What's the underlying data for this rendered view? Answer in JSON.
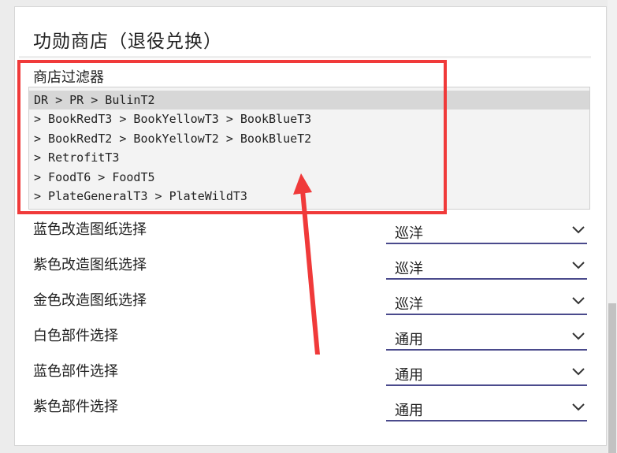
{
  "page": {
    "title": "功勋商店（退役兑换）"
  },
  "filter": {
    "label": "商店过滤器",
    "lines": [
      "DR > PR > BulinT2",
      "> BookRedT3 > BookYellowT3 > BookBlueT3",
      "> BookRedT2 > BookYellowT2 > BookBlueT2",
      "> RetrofitT3",
      "> FoodT6 > FoodT5",
      "> PlateGeneralT3 > PlateWildT3"
    ]
  },
  "settings": [
    {
      "label": "蓝色改造图纸选择",
      "value": "巡洋"
    },
    {
      "label": "紫色改造图纸选择",
      "value": "巡洋"
    },
    {
      "label": "金色改造图纸选择",
      "value": "巡洋"
    },
    {
      "label": "白色部件选择",
      "value": "通用"
    },
    {
      "label": "蓝色部件选择",
      "value": "通用"
    },
    {
      "label": "紫色部件选择",
      "value": "通用"
    }
  ],
  "colors": {
    "annotation": "#f03a3a",
    "select_underline": "#4a4a8c",
    "selected_line_bg": "#d7d7d7"
  },
  "icons": {
    "select_chevron": "chevron-down-icon",
    "annotation_arrow": "red-arrow-annotation"
  }
}
